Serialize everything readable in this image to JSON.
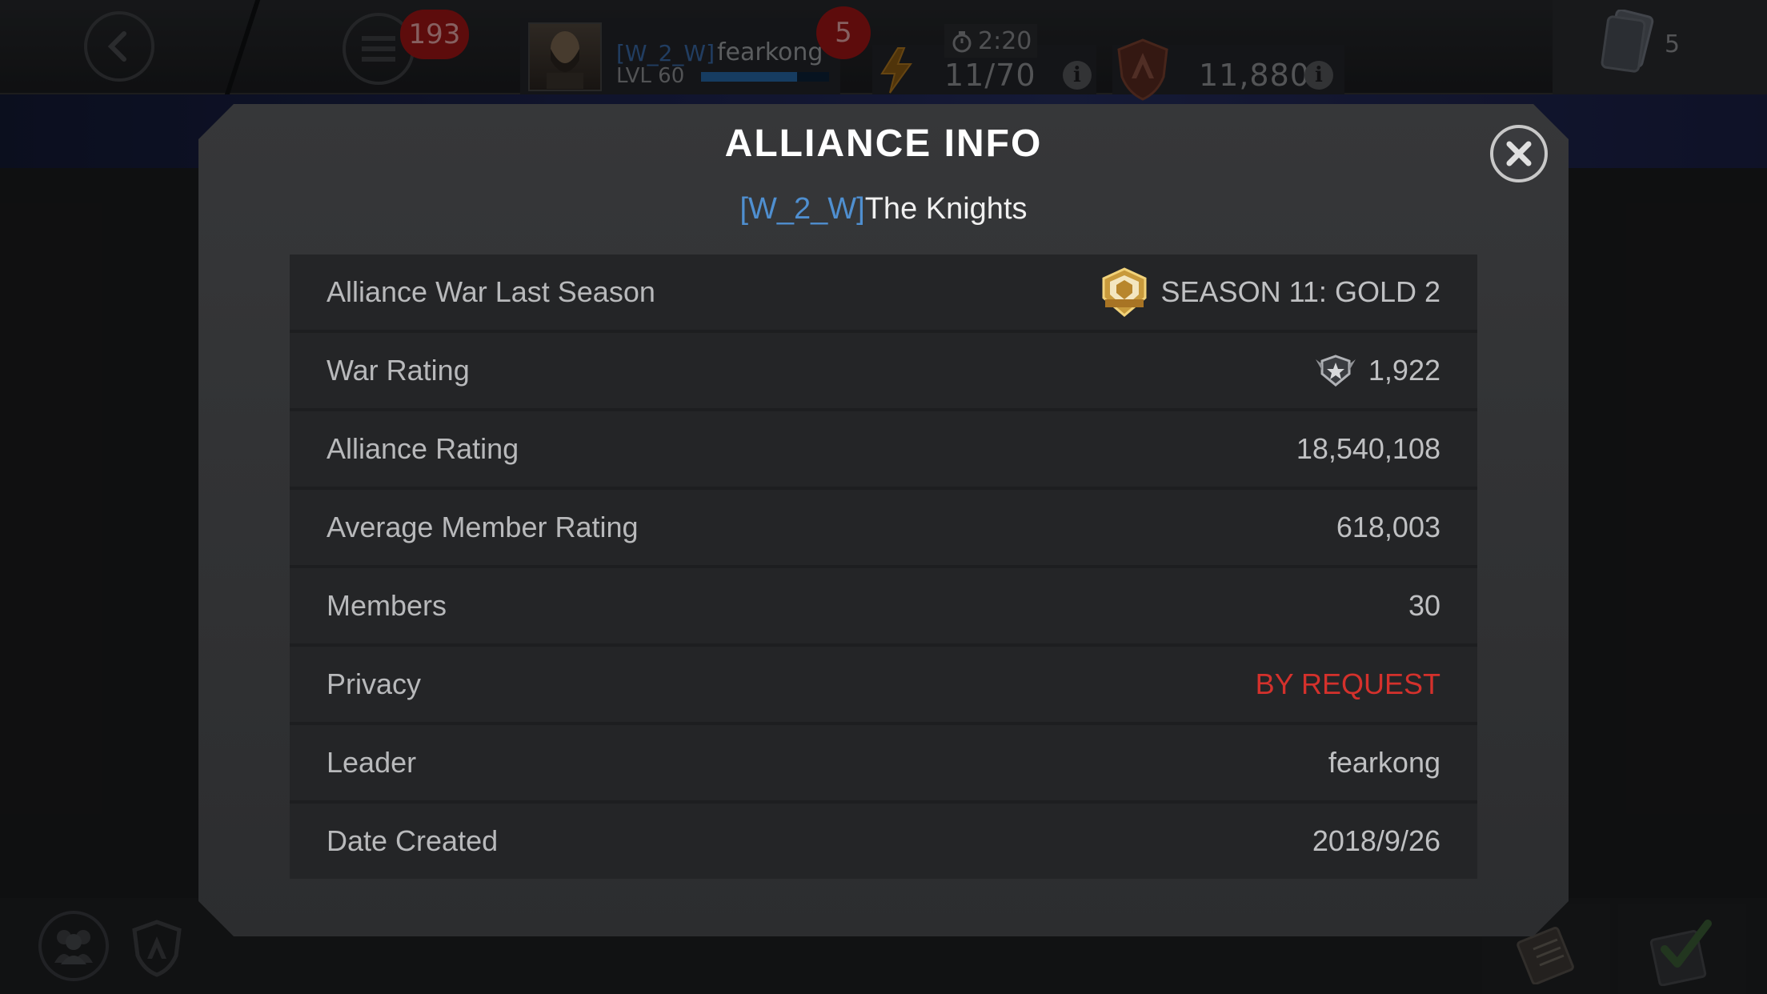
{
  "topbar": {
    "menu_badge": "193",
    "player": {
      "alliance_tag": "[W_2_W]",
      "name": "fearkong",
      "level": "LVL 60",
      "xp_fraction": 0.75,
      "badge": "5"
    },
    "timer": "2:20",
    "energy": "11/70",
    "shield_value": "11,880",
    "card_count": "5",
    "icons": [
      "back-arrow-icon",
      "menu-icon",
      "lightning-icon",
      "stopwatch-icon",
      "info-icon",
      "shield-icon",
      "card-icon"
    ]
  },
  "modal": {
    "title": "ALLIANCE INFO",
    "alliance_tag": "[W_2_W]",
    "alliance_name": "The Knights",
    "rows": [
      {
        "label": "Alliance War Last Season",
        "value": "SEASON 11: GOLD 2",
        "icon": "gold-season-icon"
      },
      {
        "label": "War Rating",
        "value": "1,922",
        "icon": "war-rating-icon"
      },
      {
        "label": "Alliance Rating",
        "value": "18,540,108"
      },
      {
        "label": "Average Member Rating",
        "value": "618,003"
      },
      {
        "label": "Members",
        "value": "30"
      },
      {
        "label": "Privacy",
        "value": "BY REQUEST",
        "color": "#d4312c"
      },
      {
        "label": "Leader",
        "value": "fearkong"
      },
      {
        "label": "Date Created",
        "value": "2018/9/26"
      }
    ]
  },
  "bottombar": {
    "icons": [
      "alliance-members-icon",
      "alliance-shield-icon",
      "clipboard-icon",
      "checkmark-icon"
    ]
  },
  "colors": {
    "alliance_tag": "#4f8fd0",
    "privacy_red": "#d4312c",
    "badge_red": "#a01616"
  }
}
